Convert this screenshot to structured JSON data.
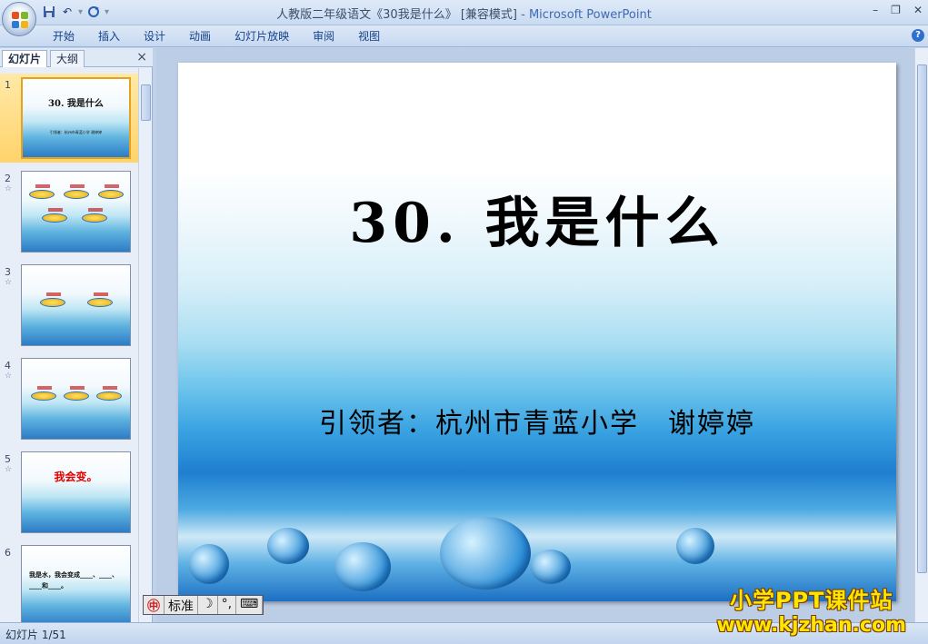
{
  "window": {
    "title": "人教版二年级语文《30我是什么》 [兼容模式]",
    "app_suffix": "- Microsoft PowerPoint",
    "min": "–",
    "restore": "❐",
    "close": "✕"
  },
  "quick_access": [
    "save-icon",
    "undo-icon",
    "redo-icon",
    "customize-icon"
  ],
  "ribbon": {
    "tabs": [
      "开始",
      "插入",
      "设计",
      "动画",
      "幻灯片放映",
      "审阅",
      "视图"
    ],
    "help": "?"
  },
  "pane": {
    "tab_slides": "幻灯片",
    "tab_outline": "大纲",
    "close": "×",
    "thumbnails": [
      {
        "num": "1",
        "title": "30. 我是什么",
        "sub": "引领者：杭州市青蓝小学 谢婷婷",
        "selected": true
      },
      {
        "num": "2",
        "star": "☆",
        "selected": false
      },
      {
        "num": "3",
        "star": "☆",
        "selected": false
      },
      {
        "num": "4",
        "star": "☆",
        "selected": false
      },
      {
        "num": "5",
        "star": "☆",
        "text": "我会变。",
        "selected": false
      },
      {
        "num": "6",
        "text": "我是水，我会变成____、____、____和____。",
        "selected": false
      }
    ]
  },
  "slide": {
    "title": "30. 我是什么",
    "subtitle": "引领者：杭州市青蓝小学　谢婷婷"
  },
  "ime": {
    "mode": "标准",
    "moon": "☽",
    "punct": "°,",
    "keyboard": "⌨"
  },
  "status": {
    "slide_counter": "幻灯片 1/51"
  },
  "watermark": {
    "line1": "小学PPT课件站",
    "line2": "www.kjzhan.com"
  },
  "colors": {
    "ribbon_text": "#15428b",
    "selected_thumb": "#ffd36b",
    "watermark": "#ffe600"
  }
}
